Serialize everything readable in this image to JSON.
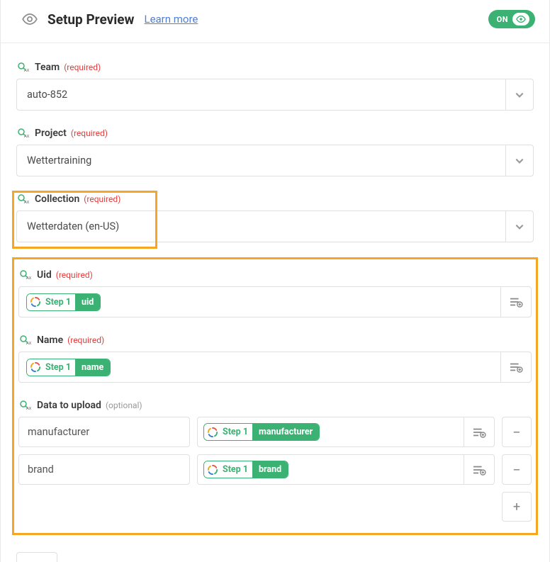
{
  "header": {
    "title": "Setup Preview",
    "learn": "Learn more",
    "toggle_label": "ON"
  },
  "labels": {
    "team": "Team",
    "project": "Project",
    "collection": "Collection",
    "uid": "Uid",
    "name": "Name",
    "data": "Data to upload",
    "required": "(required)",
    "optional": "(optional)"
  },
  "values": {
    "team": "auto-852",
    "project": "Wettertraining",
    "collection": "Wetterdaten (en-US)"
  },
  "chips": {
    "step": "Step 1",
    "uid_attr": "uid",
    "name_attr": "name",
    "manu_attr": "manufacturer",
    "brand_attr": "brand"
  },
  "uploads": {
    "key1": "manufacturer",
    "key2": "brand"
  },
  "icons": {
    "qax_prefix": "Q",
    "qax_sub": "AX"
  },
  "colors": {
    "accent_green": "#3bb273",
    "highlight": "#f5a623",
    "link": "#4f7fd8",
    "required": "#e23b3b"
  }
}
